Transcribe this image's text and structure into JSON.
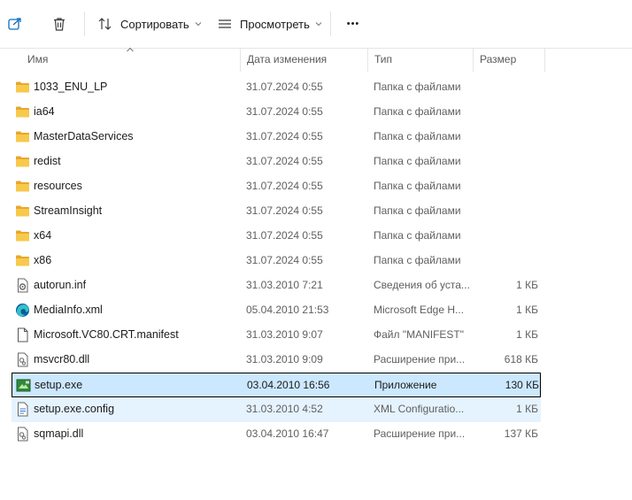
{
  "toolbar": {
    "sort_label": "Сортировать",
    "view_label": "Просмотреть",
    "more_label": "•••"
  },
  "columns": {
    "name": "Имя",
    "date": "Дата изменения",
    "type": "Тип",
    "size": "Размер"
  },
  "colors": {
    "folder": "#f7c94c",
    "selected_bg": "#cce8ff",
    "hover_bg": "#e5f3ff"
  },
  "files": [
    {
      "name": "1033_ENU_LP",
      "date": "31.07.2024 0:55",
      "type": "Папка с файлами",
      "size": "",
      "icon": "folder-icon"
    },
    {
      "name": "ia64",
      "date": "31.07.2024 0:55",
      "type": "Папка с файлами",
      "size": "",
      "icon": "folder-icon"
    },
    {
      "name": "MasterDataServices",
      "date": "31.07.2024 0:55",
      "type": "Папка с файлами",
      "size": "",
      "icon": "folder-icon"
    },
    {
      "name": "redist",
      "date": "31.07.2024 0:55",
      "type": "Папка с файлами",
      "size": "",
      "icon": "folder-icon"
    },
    {
      "name": "resources",
      "date": "31.07.2024 0:55",
      "type": "Папка с файлами",
      "size": "",
      "icon": "folder-icon"
    },
    {
      "name": "StreamInsight",
      "date": "31.07.2024 0:55",
      "type": "Папка с файлами",
      "size": "",
      "icon": "folder-icon"
    },
    {
      "name": "x64",
      "date": "31.07.2024 0:55",
      "type": "Папка с файлами",
      "size": "",
      "icon": "folder-icon"
    },
    {
      "name": "x86",
      "date": "31.07.2024 0:55",
      "type": "Папка с файлами",
      "size": "",
      "icon": "folder-icon"
    },
    {
      "name": "autorun.inf",
      "date": "31.03.2010 7:21",
      "type": "Сведения об уста...",
      "size": "1 КБ",
      "icon": "settings-file-icon"
    },
    {
      "name": "MediaInfo.xml",
      "date": "05.04.2010 21:53",
      "type": "Microsoft Edge H...",
      "size": "1 КБ",
      "icon": "edge-icon"
    },
    {
      "name": "Microsoft.VC80.CRT.manifest",
      "date": "31.03.2010 9:07",
      "type": "Файл \"MANIFEST\"",
      "size": "1 КБ",
      "icon": "file-icon"
    },
    {
      "name": "msvcr80.dll",
      "date": "31.03.2010 9:09",
      "type": "Расширение при...",
      "size": "618 КБ",
      "icon": "dll-icon"
    },
    {
      "name": "setup.exe",
      "date": "03.04.2010 16:56",
      "type": "Приложение",
      "size": "130 КБ",
      "icon": "setup-exe-icon",
      "state": "selected"
    },
    {
      "name": "setup.exe.config",
      "date": "31.03.2010 4:52",
      "type": "XML Configuratio...",
      "size": "1 КБ",
      "icon": "config-file-icon",
      "state": "hover"
    },
    {
      "name": "sqmapi.dll",
      "date": "03.04.2010 16:47",
      "type": "Расширение при...",
      "size": "137 КБ",
      "icon": "dll-icon"
    }
  ]
}
